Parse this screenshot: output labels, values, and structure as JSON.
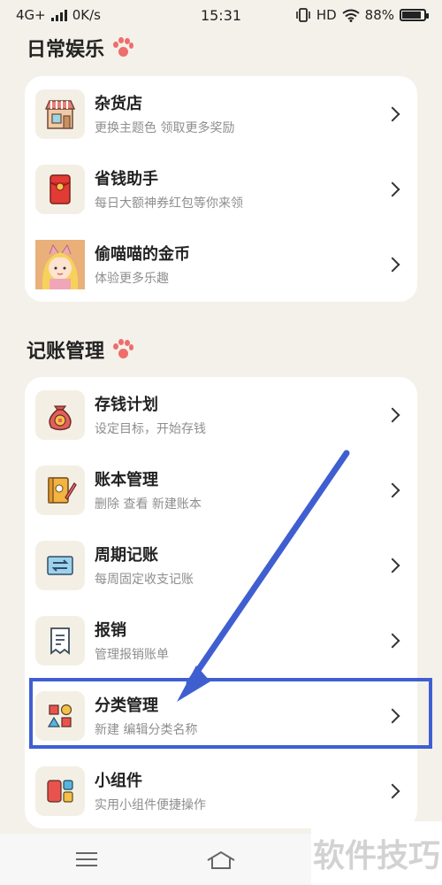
{
  "status_bar": {
    "network": "4G+",
    "speed": "0K/s",
    "time": "15:31",
    "hd": "HD",
    "battery": "88%",
    "battery_level": 0.88
  },
  "daily_section": {
    "title": "日常娱乐",
    "items": [
      {
        "title": "杂货店",
        "subtitle": "更换主题色 领取更多奖励",
        "icon": "shop-icon"
      },
      {
        "title": "省钱助手",
        "subtitle": "每日大额神券红包等你来领",
        "icon": "red-envelope-icon"
      },
      {
        "title": "偷喵喵的金币",
        "subtitle": "体验更多乐趣",
        "icon": "cat-girl-avatar-icon"
      }
    ]
  },
  "accounting_section": {
    "title": "记账管理",
    "items": [
      {
        "title": "存钱计划",
        "subtitle": "设定目标，开始存钱",
        "icon": "money-bag-icon"
      },
      {
        "title": "账本管理",
        "subtitle": "删除 查看 新建账本",
        "icon": "ledger-icon"
      },
      {
        "title": "周期记账",
        "subtitle": "每周固定收支记账",
        "icon": "cycle-icon"
      },
      {
        "title": "报销",
        "subtitle": "管理报销账单",
        "icon": "receipt-icon"
      },
      {
        "title": "分类管理",
        "subtitle": "新建 编辑分类名称",
        "icon": "category-shapes-icon"
      },
      {
        "title": "小组件",
        "subtitle": "实用小组件便捷操作",
        "icon": "widget-icon"
      }
    ]
  },
  "watermark": "软件技巧",
  "colors": {
    "background": "#f4f1ea",
    "card": "#ffffff",
    "paw": "#ef6d6a",
    "annotation": "#3f5fd1"
  }
}
